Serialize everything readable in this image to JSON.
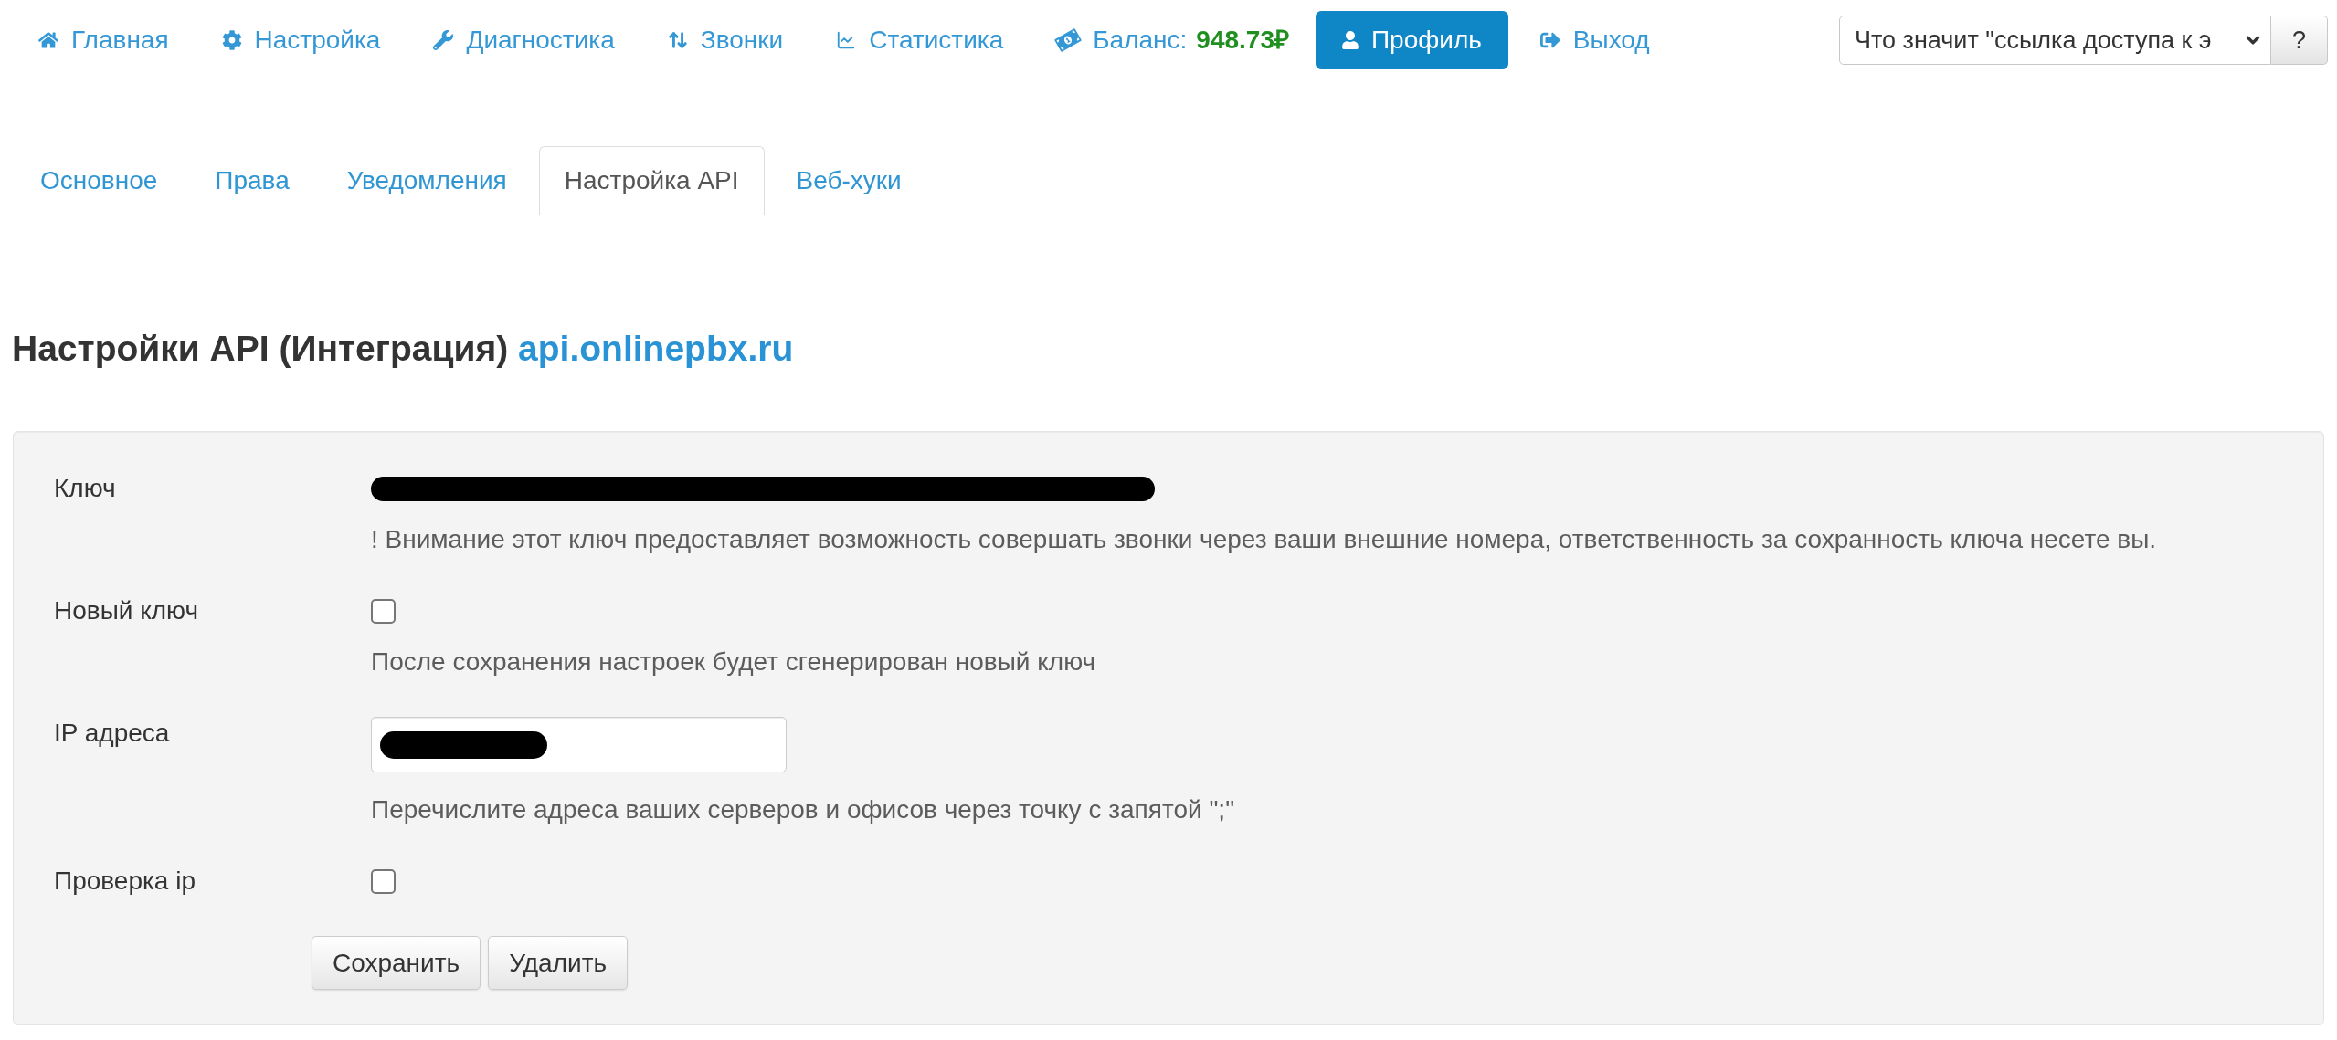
{
  "nav": {
    "items": [
      {
        "label": "Главная",
        "selected": false
      },
      {
        "label": "Настройка",
        "selected": false
      },
      {
        "label": "Диагностика",
        "selected": false
      },
      {
        "label": "Звонки",
        "selected": false
      },
      {
        "label": "Статистика",
        "selected": false
      },
      {
        "label": "Баланс:",
        "value": "948.73₽",
        "selected": false
      },
      {
        "label": "Профиль",
        "selected": true
      },
      {
        "label": "Выход",
        "selected": false
      }
    ]
  },
  "help": {
    "select": {
      "value": "Что значит \"ссылка доступа к э"
    },
    "button": "?"
  },
  "tabs": [
    {
      "label": "Основное",
      "selected": false
    },
    {
      "label": "Права",
      "selected": false
    },
    {
      "label": "Уведомления",
      "selected": false
    },
    {
      "label": "Настройка API",
      "selected": true
    },
    {
      "label": "Веб-хуки",
      "selected": false
    }
  ],
  "heading": {
    "title": "Настройки API (Интеграция)",
    "link": "api.onlinepbx.ru"
  },
  "form": {
    "rows": [
      {
        "kind": "secret",
        "label": "Ключ",
        "redacted": true,
        "hint": "! Внимание этот ключ предоставляет возможность совершать звонки через ваши внешние номера, ответственность за сохранность ключа несете вы."
      },
      {
        "kind": "checkbox",
        "label": "Новый ключ",
        "checked": false,
        "hint": "После сохранения настроек будет сгенерирован новый ключ"
      },
      {
        "kind": "input",
        "label": "IP адреса",
        "redacted": true,
        "hint": "Перечислите адреса ваших серверов и офисов через точку с запятой \";\""
      },
      {
        "kind": "checkbox",
        "label": "Проверка ip",
        "checked": false
      }
    ],
    "buttons": [
      "Сохранить",
      "Удалить"
    ]
  }
}
